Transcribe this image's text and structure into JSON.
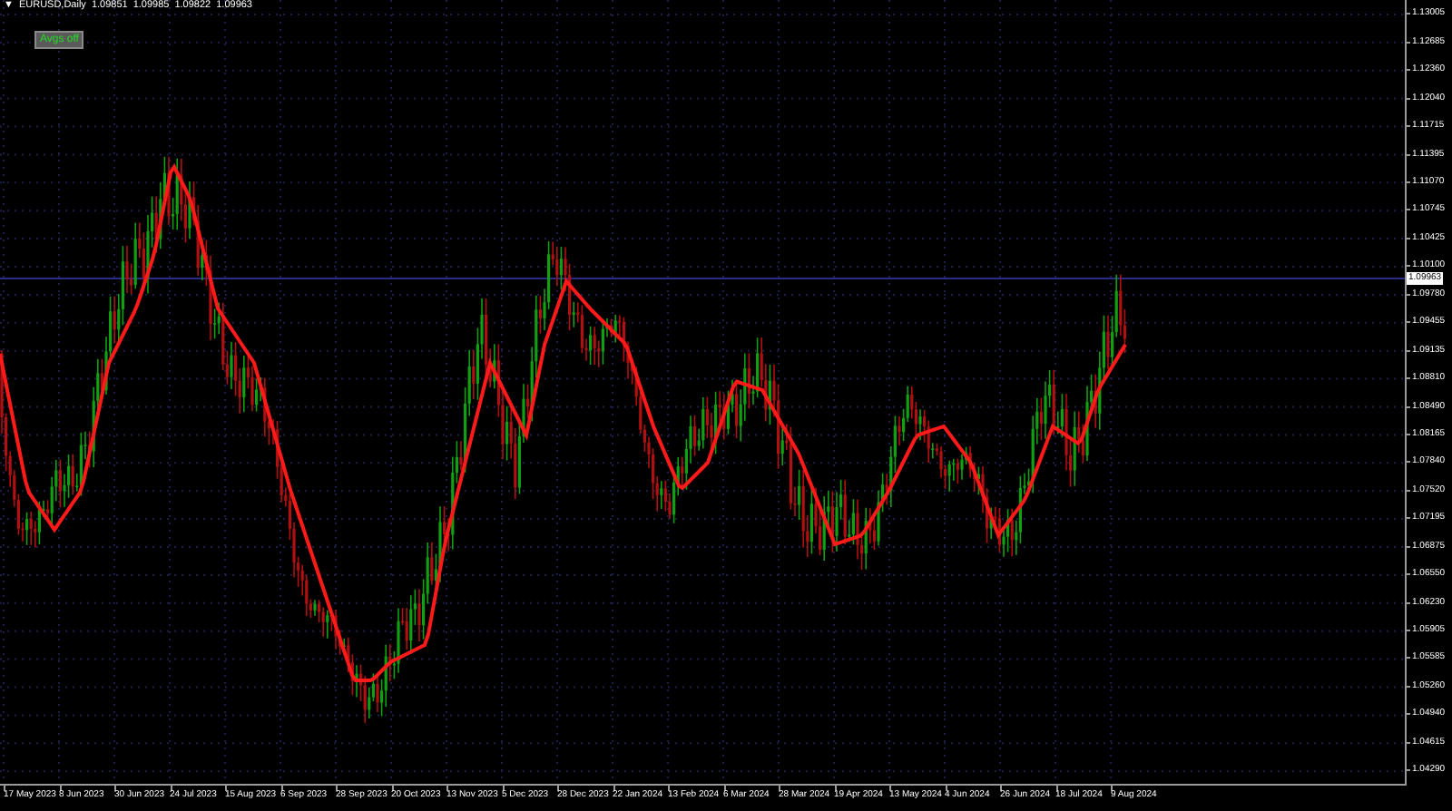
{
  "symbol_bar": {
    "collapse_glyph": "▼",
    "title": "EURUSD,Daily",
    "prices": [
      "1.09851",
      "1.09985",
      "1.09822",
      "1.09963"
    ]
  },
  "button": {
    "label": "Avgs off"
  },
  "price_axis": {
    "labels": [
      "1.13005",
      "1.12685",
      "1.12360",
      "1.12040",
      "1.11715",
      "1.11395",
      "1.11070",
      "1.10745",
      "1.10425",
      "1.10100",
      "1.09780",
      "1.09455",
      "1.09135",
      "1.08810",
      "1.08490",
      "1.08165",
      "1.07840",
      "1.07520",
      "1.07195",
      "1.06875",
      "1.06550",
      "1.06230",
      "1.05905",
      "1.05585",
      "1.05260",
      "1.04940",
      "1.04615",
      "1.04290"
    ]
  },
  "current_price": {
    "label": "1.09963"
  },
  "time_axis": {
    "labels": [
      "17 May 2023",
      "8 Jun 2023",
      "30 Jun 2023",
      "24 Jul 2023",
      "15 Aug 2023",
      "6 Sep 2023",
      "28 Sep 2023",
      "20 Oct 2023",
      "13 Nov 2023",
      "5 Dec 2023",
      "28 Dec 2023",
      "22 Jan 2024",
      "13 Feb 2024",
      "6 Mar 2024",
      "28 Mar 2024",
      "19 Apr 2024",
      "13 May 2024",
      "4 Jun 2024",
      "26 Jun 2024",
      "18 Jul 2024",
      "9 Aug 2024"
    ]
  }
}
